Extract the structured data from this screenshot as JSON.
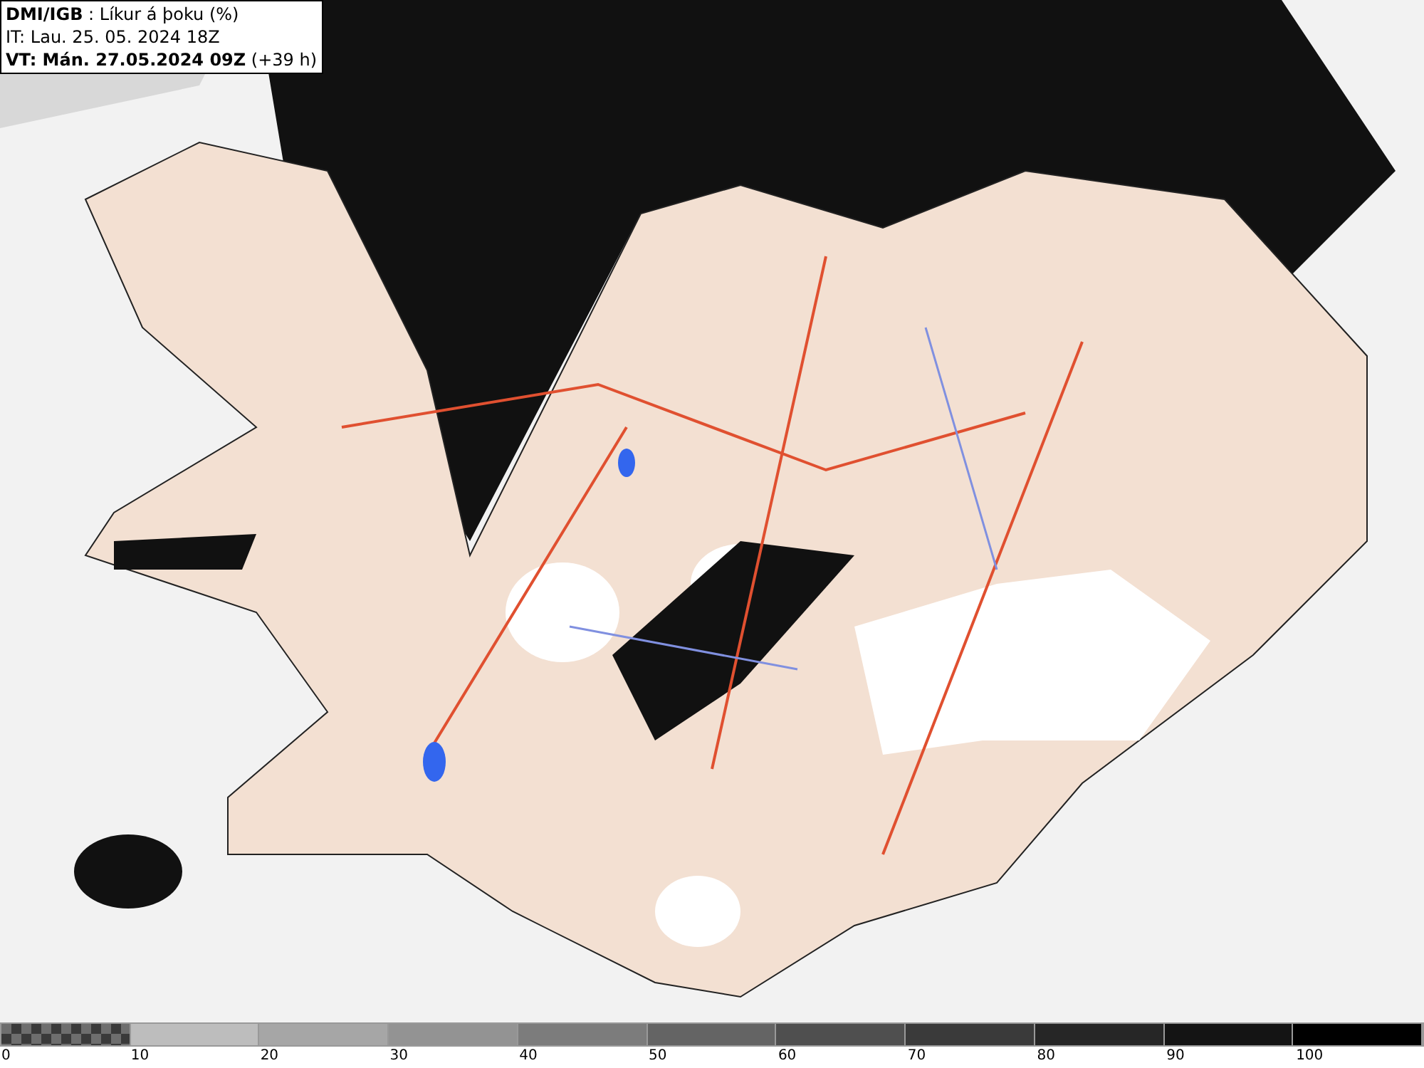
{
  "header": {
    "lines": [
      "**DMI/IGB** : Líkur á þoku (%)",
      "IT: Lau. 25. 05. 2024 18Z",
      "**VT: Mán. 27.05.2024 09Z** (+39 h)"
    ]
  },
  "legend": {
    "swatches": [
      {
        "kind": "checker",
        "color": "#6e6e6e"
      },
      {
        "kind": "solid",
        "color": "#bdbdbd"
      },
      {
        "kind": "solid",
        "color": "#a6a6a6"
      },
      {
        "kind": "solid",
        "color": "#939393"
      },
      {
        "kind": "solid",
        "color": "#7c7c7c"
      },
      {
        "kind": "solid",
        "color": "#646464"
      },
      {
        "kind": "solid",
        "color": "#4f4f4f"
      },
      {
        "kind": "solid",
        "color": "#3a3a3a"
      },
      {
        "kind": "solid",
        "color": "#262626"
      },
      {
        "kind": "solid",
        "color": "#141414"
      },
      {
        "kind": "solid",
        "color": "#000000"
      }
    ],
    "labels": [
      "0",
      "10",
      "20",
      "30",
      "40",
      "50",
      "60",
      "70",
      "80",
      "90",
      "100"
    ]
  }
}
